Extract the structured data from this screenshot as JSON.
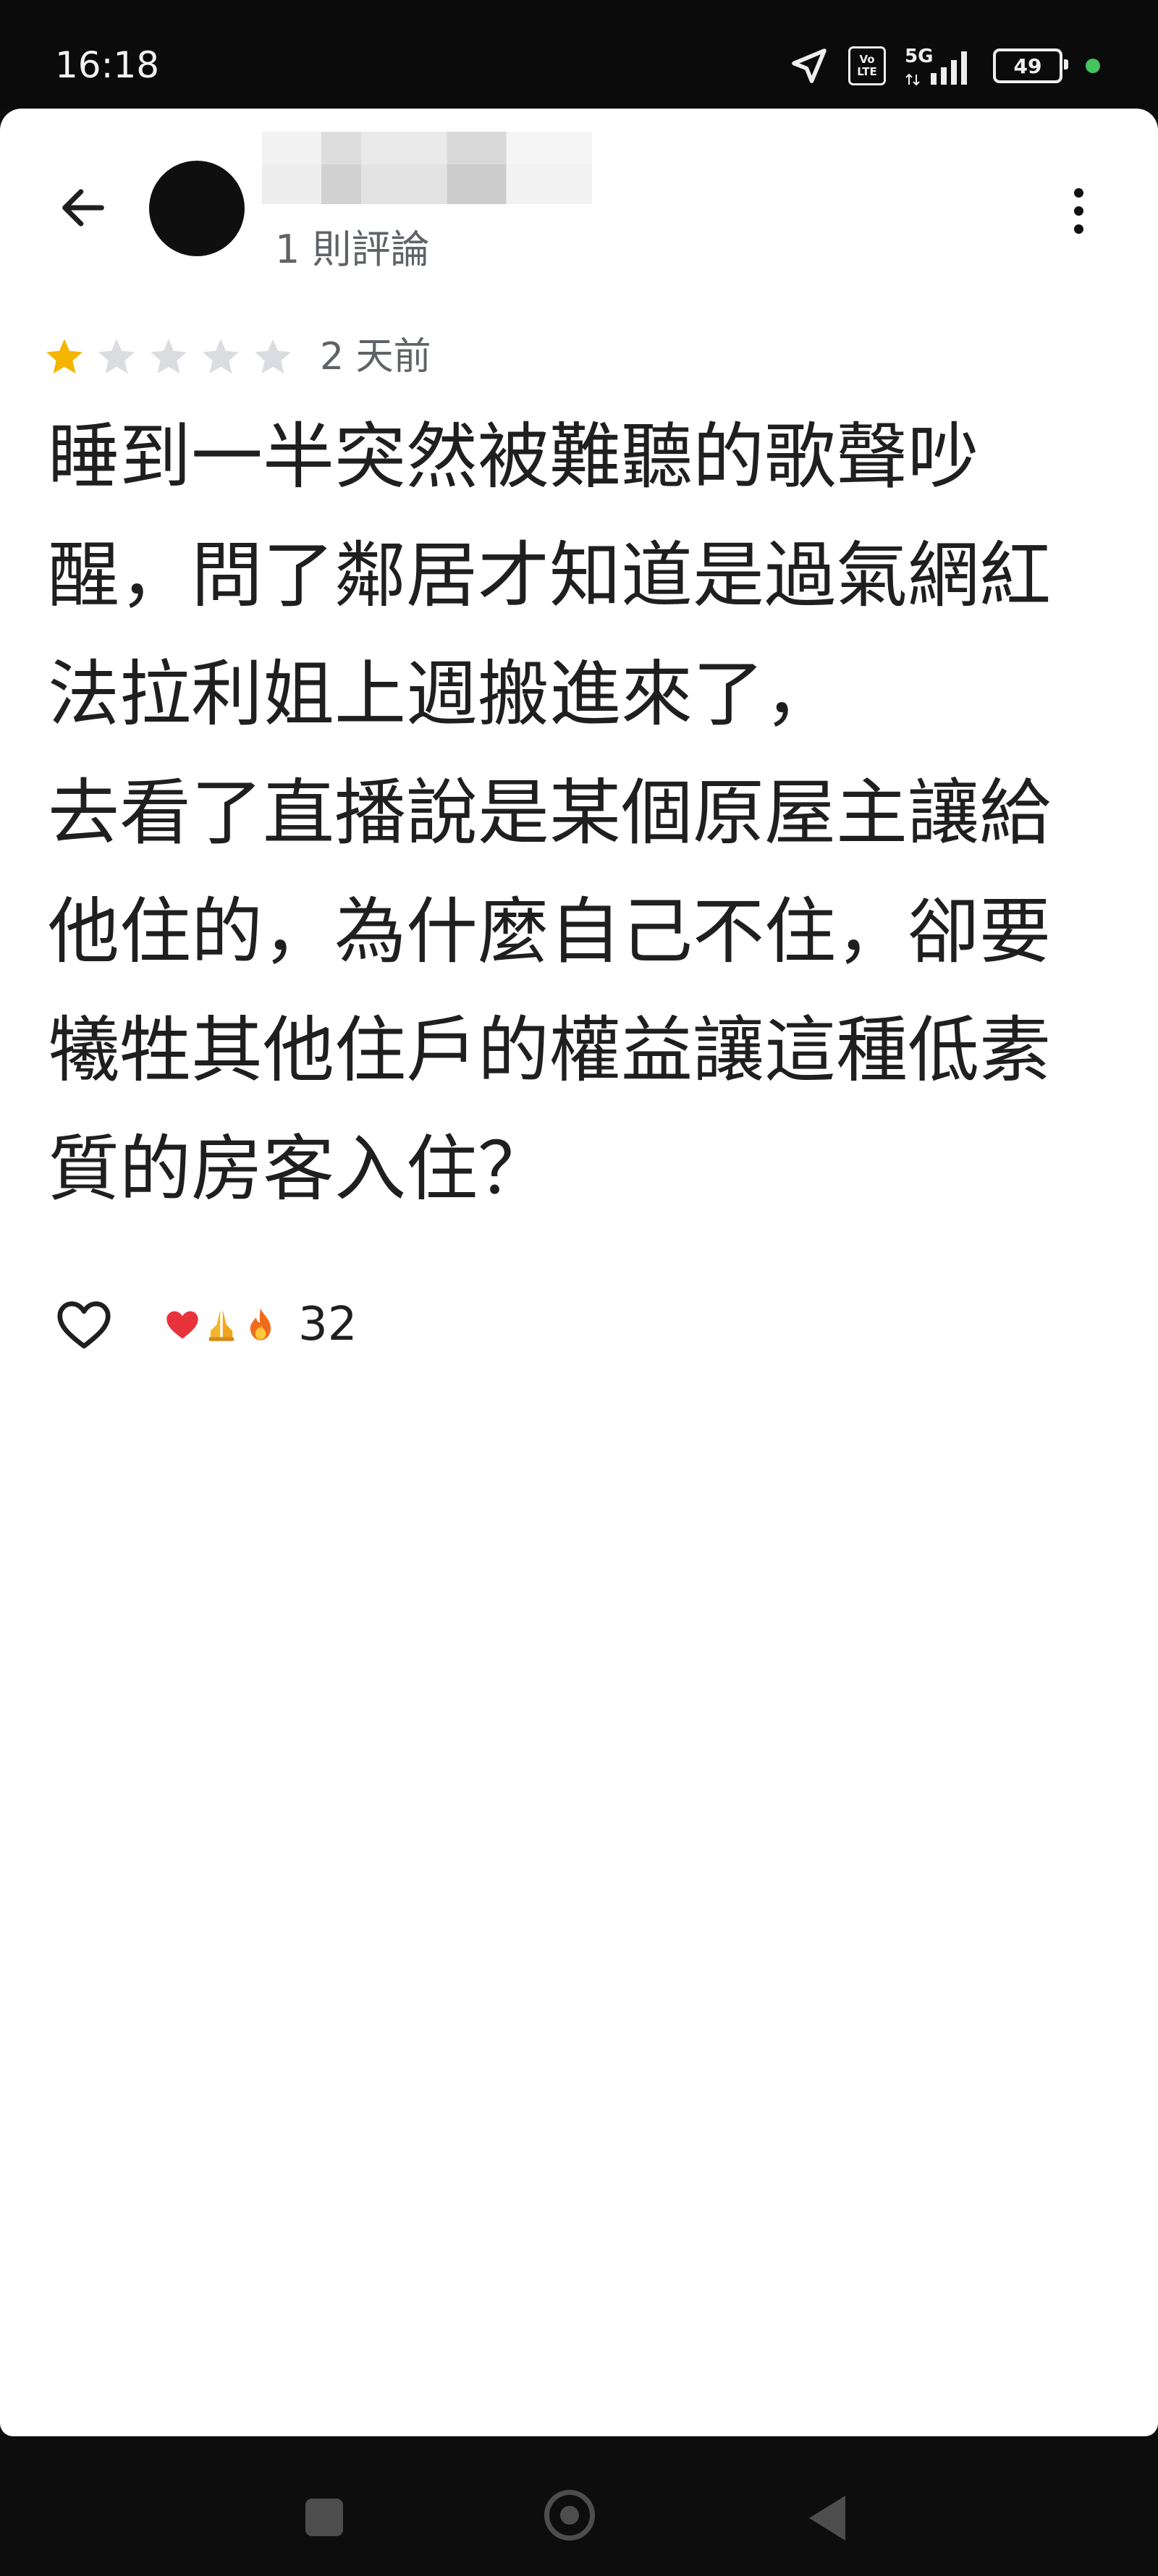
{
  "status_bar": {
    "time": "16:18",
    "icons": [
      "location-arrow-icon",
      "volte-icon",
      "5g-signal-icon",
      "battery-icon",
      "privacy-dot-icon"
    ],
    "volte_top": "Vo",
    "volte_bottom": "LTE",
    "network": "5G",
    "battery_level": "49",
    "privacy_dot_color": "#45c35c"
  },
  "review": {
    "author_review_count": "1 則評論",
    "rating": 1,
    "rating_max": 5,
    "star_color": "#f4b400",
    "star_empty_color": "#dadce0",
    "date": "2 天前",
    "lines": [
      "睡到一半突然被難聽的歌聲吵",
      "醒，問了鄰居才知道是過氣網紅",
      "法拉利姐上週搬進來了，",
      "去看了直播說是某個原屋主讓給",
      "他住的，為什麼自己不住，卻要",
      "犧牲其他住戶的權益讓這種低素",
      "質的房客入住？"
    ]
  },
  "reactions": {
    "emojis": [
      "❤️",
      "🙏",
      "🔥"
    ],
    "count": "32"
  },
  "nav_bar": {
    "buttons": [
      "recents-button",
      "home-button",
      "back-button"
    ]
  }
}
